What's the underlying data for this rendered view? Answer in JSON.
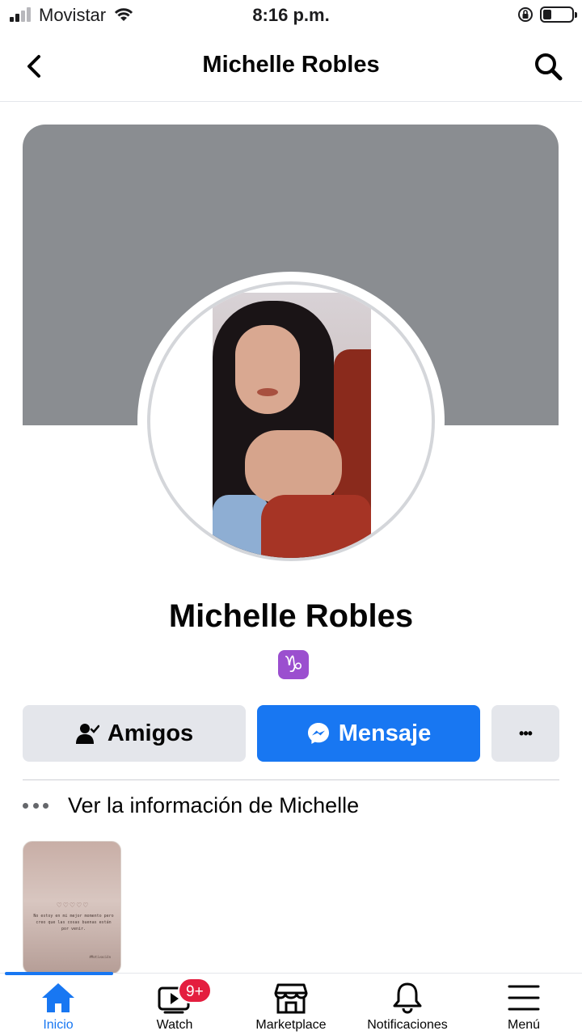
{
  "status_bar": {
    "carrier": "Movistar",
    "time": "8:16 p.m."
  },
  "header": {
    "title": "Michelle Robles",
    "back_icon": "chevron-left-icon",
    "search_icon": "search-icon"
  },
  "profile": {
    "name": "Michelle Robles",
    "zodiac_badge": "♑",
    "actions": {
      "friends_label": "Amigos",
      "message_label": "Mensaje",
      "more_label": "•••"
    },
    "about_link": "Ver la información de Michelle"
  },
  "featured_card": {
    "hearts": "♡♡♡♡♡",
    "text": "No estoy en mi mejor momento pero creo que las cosas buenas están por venir.",
    "signature": "#Motivación"
  },
  "tabbar": {
    "tabs": [
      {
        "label": "Inicio",
        "icon": "home-icon",
        "active": true
      },
      {
        "label": "Watch",
        "icon": "video-icon",
        "badge": "9+"
      },
      {
        "label": "Marketplace",
        "icon": "store-icon"
      },
      {
        "label": "Notificaciones",
        "icon": "bell-icon"
      },
      {
        "label": "Menú",
        "icon": "menu-icon"
      }
    ]
  },
  "colors": {
    "accent": "#1877f2",
    "badge_red": "#e41e3f",
    "cover_gray": "#8a8d91",
    "button_gray": "#e4e6eb"
  }
}
